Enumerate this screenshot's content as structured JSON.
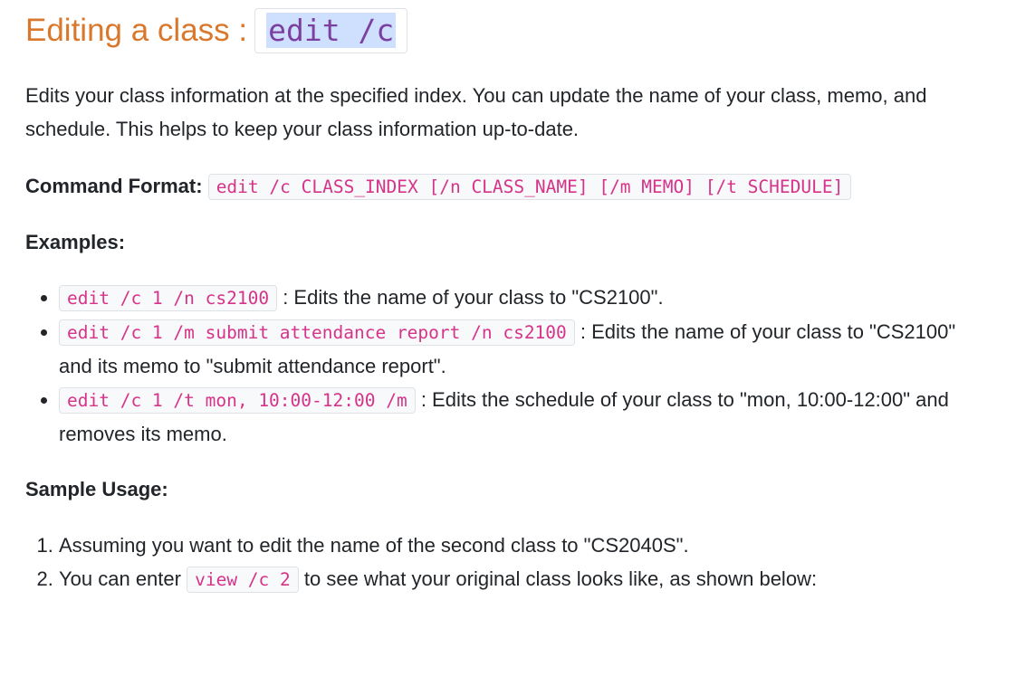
{
  "heading": {
    "text": "Editing a class :",
    "code": "edit /c"
  },
  "intro": "Edits your class information at the specified index. You can update the name of your class, memo, and schedule. This helps to keep your class information up-to-date.",
  "command_format": {
    "label": "Command Format:",
    "code": "edit /c CLASS_INDEX [/n CLASS_NAME] [/m MEMO] [/t SCHEDULE]"
  },
  "examples": {
    "label": "Examples:",
    "items": [
      {
        "code": "edit /c 1 /n cs2100",
        "text": ": Edits the name of your class to \"CS2100\"."
      },
      {
        "code": "edit /c 1 /m submit attendance report /n cs2100",
        "text": ": Edits the name of your class to \"CS2100\" and its memo to \"submit attendance report\"."
      },
      {
        "code": "edit /c 1 /t mon, 10:00-12:00 /m",
        "text": ": Edits the schedule of your class to \"mon, 10:00-12:00\" and removes its memo."
      }
    ]
  },
  "sample_usage": {
    "label": "Sample Usage:",
    "step1": "Assuming you want to edit the name of the second class to \"CS2040S\".",
    "step2_before": "You can enter",
    "step2_code": "view /c 2",
    "step2_after": "to see what your original class looks like, as shown below:"
  }
}
